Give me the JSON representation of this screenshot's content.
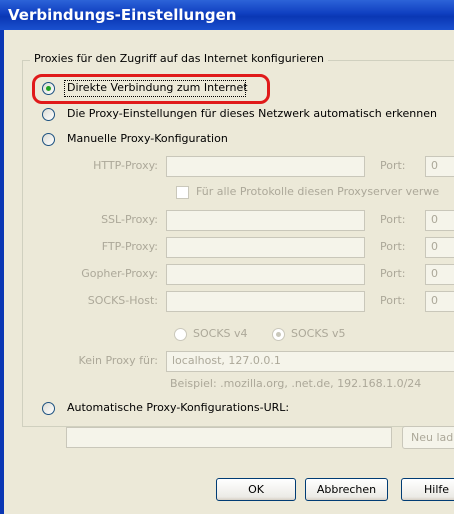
{
  "window": {
    "title": "Verbindungs-Einstellungen"
  },
  "group": {
    "legend": "Proxies für den Zugriff auf das Internet konfigurieren"
  },
  "options": {
    "direct": "Direkte Verbindung zum Internet",
    "auto_detect": "Die Proxy-Einstellungen für dieses Netzwerk automatisch erkennen",
    "manual": "Manuelle Proxy-Konfiguration",
    "auto_url": "Automatische Proxy-Konfigurations-URL:"
  },
  "manual": {
    "http_label": "HTTP-Proxy:",
    "same_proxy_label": "Für alle Protokolle diesen Proxyserver verwe",
    "ssl_label": "SSL-Proxy:",
    "ftp_label": "FTP-Proxy:",
    "gopher_label": "Gopher-Proxy:",
    "socks_label": "SOCKS-Host:",
    "port_label": "Port:",
    "port_value": "0",
    "socks_v4": "SOCKS v4",
    "socks_v5": "SOCKS v5",
    "no_proxy_label": "Kein Proxy für:",
    "no_proxy_value": "localhost, 127.0.0.1",
    "example": "Beispiel: .mozilla.org, .net.de, 192.168.1.0/24"
  },
  "auto_url": {
    "reload_button": "Neu lad"
  },
  "buttons": {
    "ok": "OK",
    "cancel": "Abbrechen",
    "help": "Hilfe"
  },
  "colors": {
    "highlight": "#e01a1a",
    "radio_dot": "#21a121",
    "titlebar": "#0a37b4"
  }
}
